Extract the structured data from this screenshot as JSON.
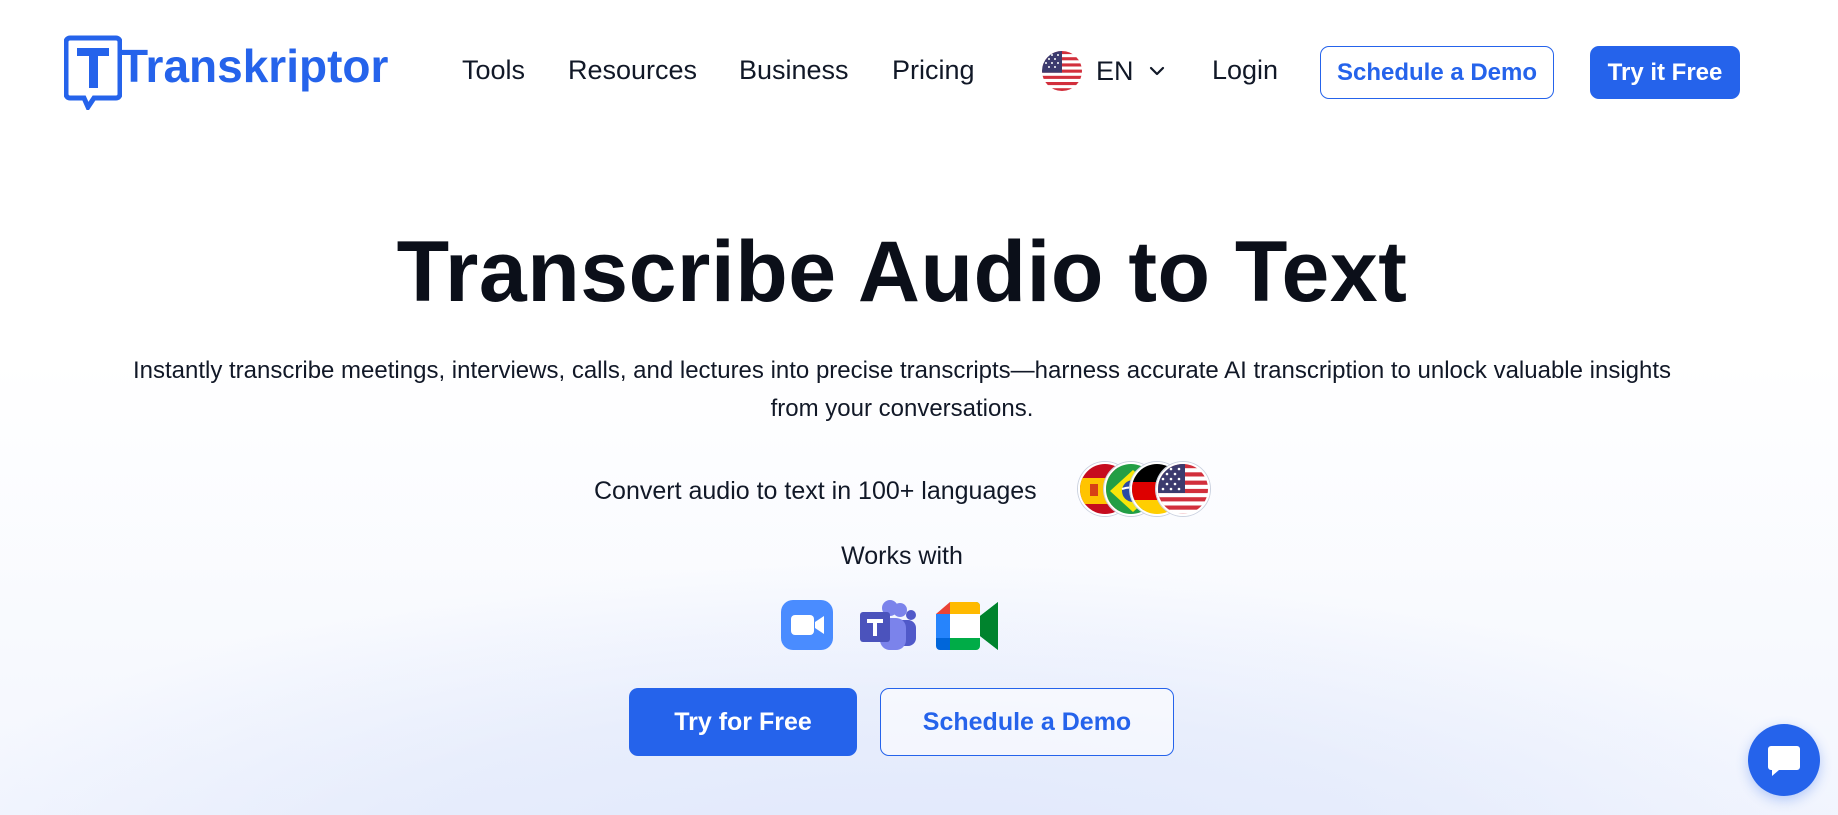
{
  "brand": {
    "name": "Transkriptor",
    "accent": "#2563eb"
  },
  "nav": {
    "links": [
      "Tools",
      "Resources",
      "Business",
      "Pricing"
    ],
    "language": {
      "code": "EN",
      "flag_icon": "us-flag-icon"
    },
    "login": "Login",
    "schedule_demo": "Schedule a Demo",
    "try_free": "Try it Free"
  },
  "hero": {
    "title": "Transcribe Audio to Text",
    "subtitle_line1": "Instantly transcribe meetings, interviews, calls, and lectures into precise transcripts—harness accurate AI transcription to unlock valuable insights",
    "subtitle_line2": "from your conversations.",
    "languages_text": "Convert audio to text in 100+ languages",
    "flags": [
      "spain-flag-icon",
      "brazil-flag-icon",
      "germany-flag-icon",
      "us-flag-icon"
    ],
    "works_with": "Works with",
    "apps": [
      "zoom-icon",
      "microsoft-teams-icon",
      "google-meet-icon"
    ],
    "cta_primary": "Try for Free",
    "cta_secondary": "Schedule a Demo"
  },
  "chat": {
    "icon": "chat-bubble-icon"
  }
}
